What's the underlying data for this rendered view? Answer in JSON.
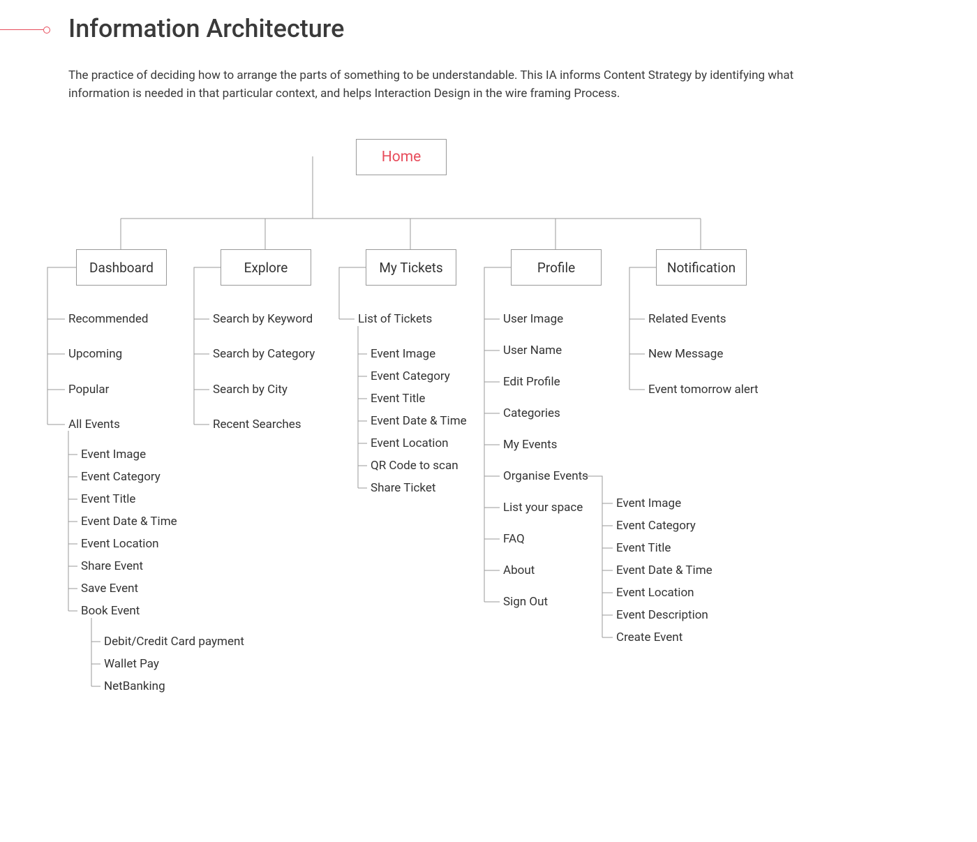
{
  "page": {
    "title": "Information Architecture",
    "description": "The practice of deciding how to arrange the parts of something to be understandable. This IA informs Content Strategy by identifying what information is needed in that particular context, and helps Interaction Design in the wire framing Process."
  },
  "ia": {
    "root": "Home",
    "branches": [
      {
        "label": "Dashboard",
        "children": [
          {
            "label": "Recommended"
          },
          {
            "label": "Upcoming"
          },
          {
            "label": "Popular"
          },
          {
            "label": "All Events",
            "children": [
              {
                "label": "Event Image"
              },
              {
                "label": "Event Category"
              },
              {
                "label": "Event Title"
              },
              {
                "label": "Event Date & Time"
              },
              {
                "label": "Event Location"
              },
              {
                "label": "Share Event"
              },
              {
                "label": "Save Event"
              },
              {
                "label": "Book Event",
                "children": [
                  {
                    "label": "Debit/Credit Card payment"
                  },
                  {
                    "label": "Wallet Pay"
                  },
                  {
                    "label": "NetBanking"
                  }
                ]
              }
            ]
          }
        ]
      },
      {
        "label": "Explore",
        "children": [
          {
            "label": "Search by Keyword"
          },
          {
            "label": "Search by Category"
          },
          {
            "label": "Search by City"
          },
          {
            "label": "Recent Searches"
          }
        ]
      },
      {
        "label": "My Tickets",
        "children": [
          {
            "label": "List of Tickets",
            "children": [
              {
                "label": "Event Image"
              },
              {
                "label": "Event Category"
              },
              {
                "label": "Event Title"
              },
              {
                "label": "Event Date & Time"
              },
              {
                "label": "Event Location"
              },
              {
                "label": "QR Code to scan"
              },
              {
                "label": "Share Ticket"
              }
            ]
          }
        ]
      },
      {
        "label": "Profile",
        "children": [
          {
            "label": "User Image"
          },
          {
            "label": "User Name"
          },
          {
            "label": "Edit Profile"
          },
          {
            "label": "Categories"
          },
          {
            "label": "My Events"
          },
          {
            "label": "Organise Events",
            "children": [
              {
                "label": "Event Image"
              },
              {
                "label": "Event Category"
              },
              {
                "label": "Event Title"
              },
              {
                "label": "Event Date & Time"
              },
              {
                "label": "Event Location"
              },
              {
                "label": "Event Description"
              },
              {
                "label": "Create Event"
              }
            ]
          },
          {
            "label": "List your space"
          },
          {
            "label": "FAQ"
          },
          {
            "label": "About"
          },
          {
            "label": "Sign Out"
          }
        ]
      },
      {
        "label": "Notification",
        "children": [
          {
            "label": "Related Events"
          },
          {
            "label": "New Message"
          },
          {
            "label": "Event tomorrow alert"
          }
        ]
      }
    ]
  }
}
